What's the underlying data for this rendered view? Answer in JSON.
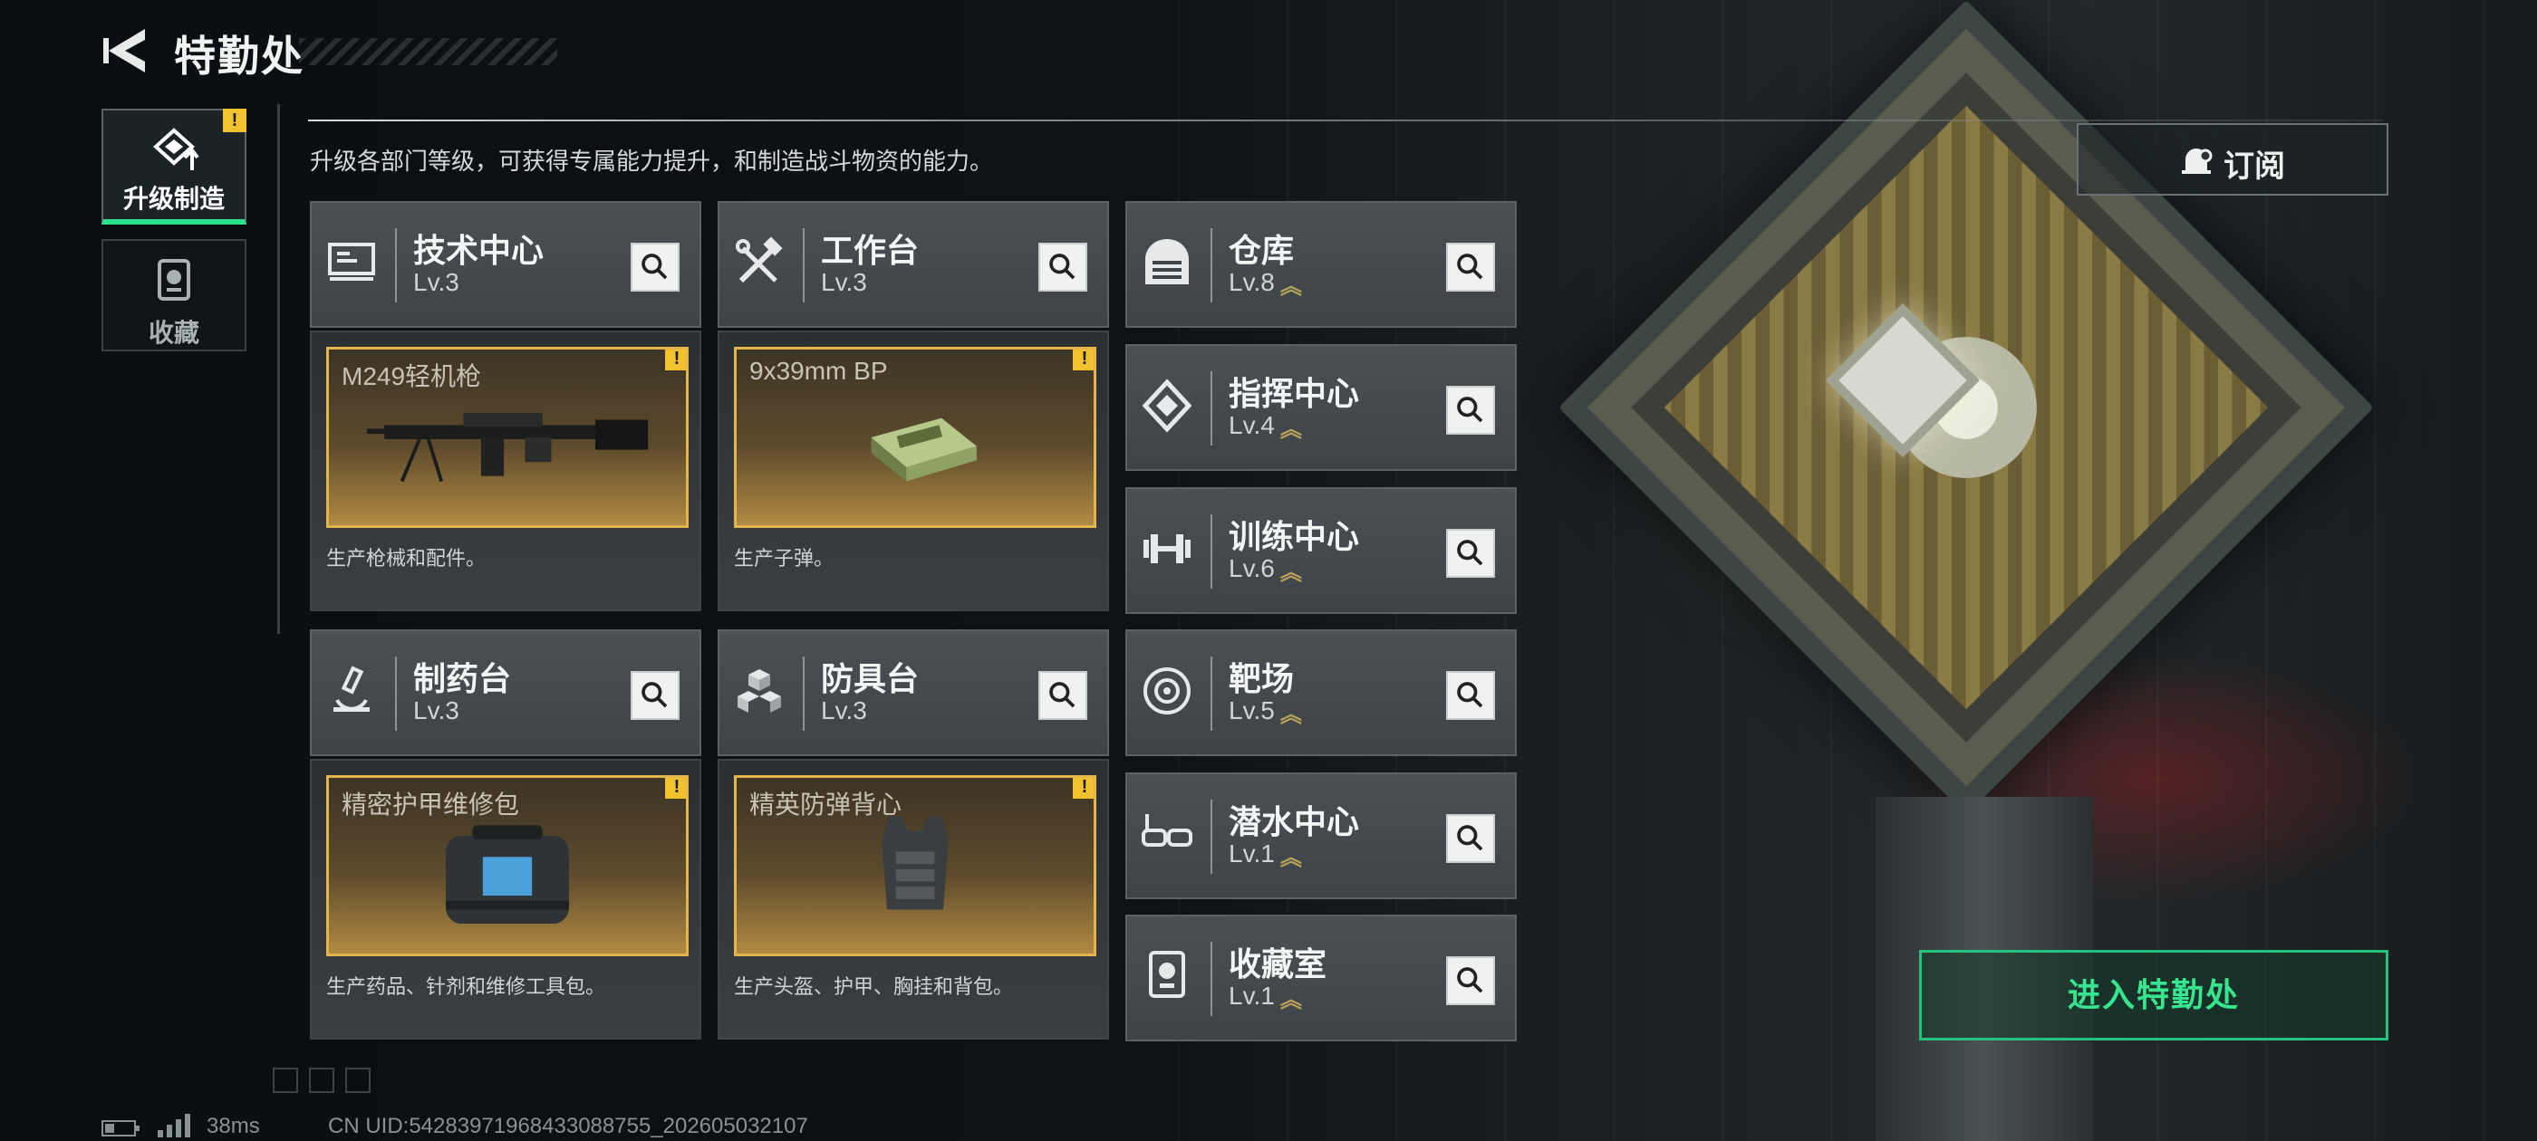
{
  "header": {
    "title": "特勤处"
  },
  "tabs": [
    {
      "label": "升级制造",
      "active": true,
      "alert": "!"
    },
    {
      "label": "收藏",
      "active": false
    }
  ],
  "description": "升级各部门等级，可获得专属能力提升，和制造战斗物资的能力。",
  "facilities_left": [
    {
      "name": "技术中心",
      "level": "Lv.3",
      "icon": "monitor-icon",
      "craft": {
        "item": "M249轻机枪",
        "alert": "!",
        "desc": "生产枪械和配件。"
      }
    },
    {
      "name": "工作台",
      "level": "Lv.3",
      "icon": "tools-icon",
      "craft": {
        "item": "9x39mm BP",
        "alert": "!",
        "desc": "生产子弹。"
      }
    },
    {
      "name": "制药台",
      "level": "Lv.3",
      "icon": "microscope-icon",
      "craft": {
        "item": "精密护甲维修包",
        "alert": "!",
        "desc": "生产药品、针剂和维修工具包。"
      }
    },
    {
      "name": "防具台",
      "level": "Lv.3",
      "icon": "boxes-icon",
      "craft": {
        "item": "精英防弹背心",
        "alert": "!",
        "desc": "生产头盔、护甲、胸挂和背包。"
      }
    }
  ],
  "facilities_right": [
    {
      "name": "仓库",
      "level": "Lv.8",
      "icon": "warehouse-icon",
      "upgradable": true
    },
    {
      "name": "指挥中心",
      "level": "Lv.4",
      "icon": "command-icon",
      "upgradable": true
    },
    {
      "name": "训练中心",
      "level": "Lv.6",
      "icon": "dumbbell-icon",
      "upgradable": true
    },
    {
      "name": "靶场",
      "level": "Lv.5",
      "icon": "target-icon",
      "upgradable": true
    },
    {
      "name": "潜水中心",
      "level": "Lv.1",
      "icon": "goggles-icon",
      "upgradable": true
    },
    {
      "name": "收藏室",
      "level": "Lv.1",
      "icon": "trophy-icon",
      "upgradable": true
    }
  ],
  "buttons": {
    "subscribe": "订阅",
    "enter": "进入特勤处"
  },
  "status": {
    "ping": "38ms",
    "uid": "CN UID:542839719684330887​55_202605032107"
  },
  "colors": {
    "accent_green": "#2ee08b",
    "alert_yellow": "#f2c12e",
    "craft_gold": "#e3b54a"
  }
}
